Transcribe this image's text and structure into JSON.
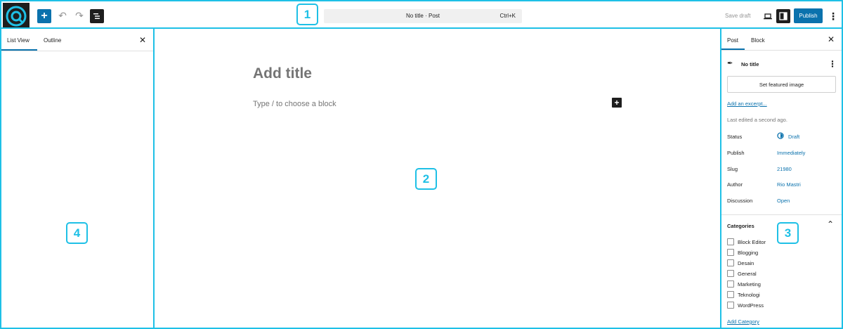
{
  "toolbar": {
    "doc_title": "No title · Post",
    "shortcut": "Ctrl+K",
    "save_draft": "Save draft",
    "publish": "Publish"
  },
  "left_panel": {
    "tabs": [
      "List View",
      "Outline"
    ]
  },
  "editor": {
    "title_placeholder": "Add title",
    "block_placeholder": "Type / to choose a block"
  },
  "sidebar": {
    "tabs": [
      "Post",
      "Block"
    ],
    "post_title": "No title",
    "featured_image_button": "Set featured image",
    "excerpt_link": "Add an excerpt...",
    "last_edited": "Last edited a second ago.",
    "fields": [
      {
        "label": "Status",
        "value": "Draft"
      },
      {
        "label": "Publish",
        "value": "Immediately"
      },
      {
        "label": "Slug",
        "value": "21980"
      },
      {
        "label": "Author",
        "value": "Rio Mastri"
      },
      {
        "label": "Discussion",
        "value": "Open"
      }
    ],
    "categories_heading": "Categories",
    "categories": [
      "Block Editor",
      "Blogging",
      "Desain",
      "General",
      "Marketing",
      "Teknologi",
      "WordPress"
    ],
    "add_category": "Add Category"
  },
  "badges": [
    "1",
    "2",
    "3",
    "4"
  ],
  "colors": {
    "accent": "#0b72ad",
    "highlight": "#1ec0e6"
  }
}
